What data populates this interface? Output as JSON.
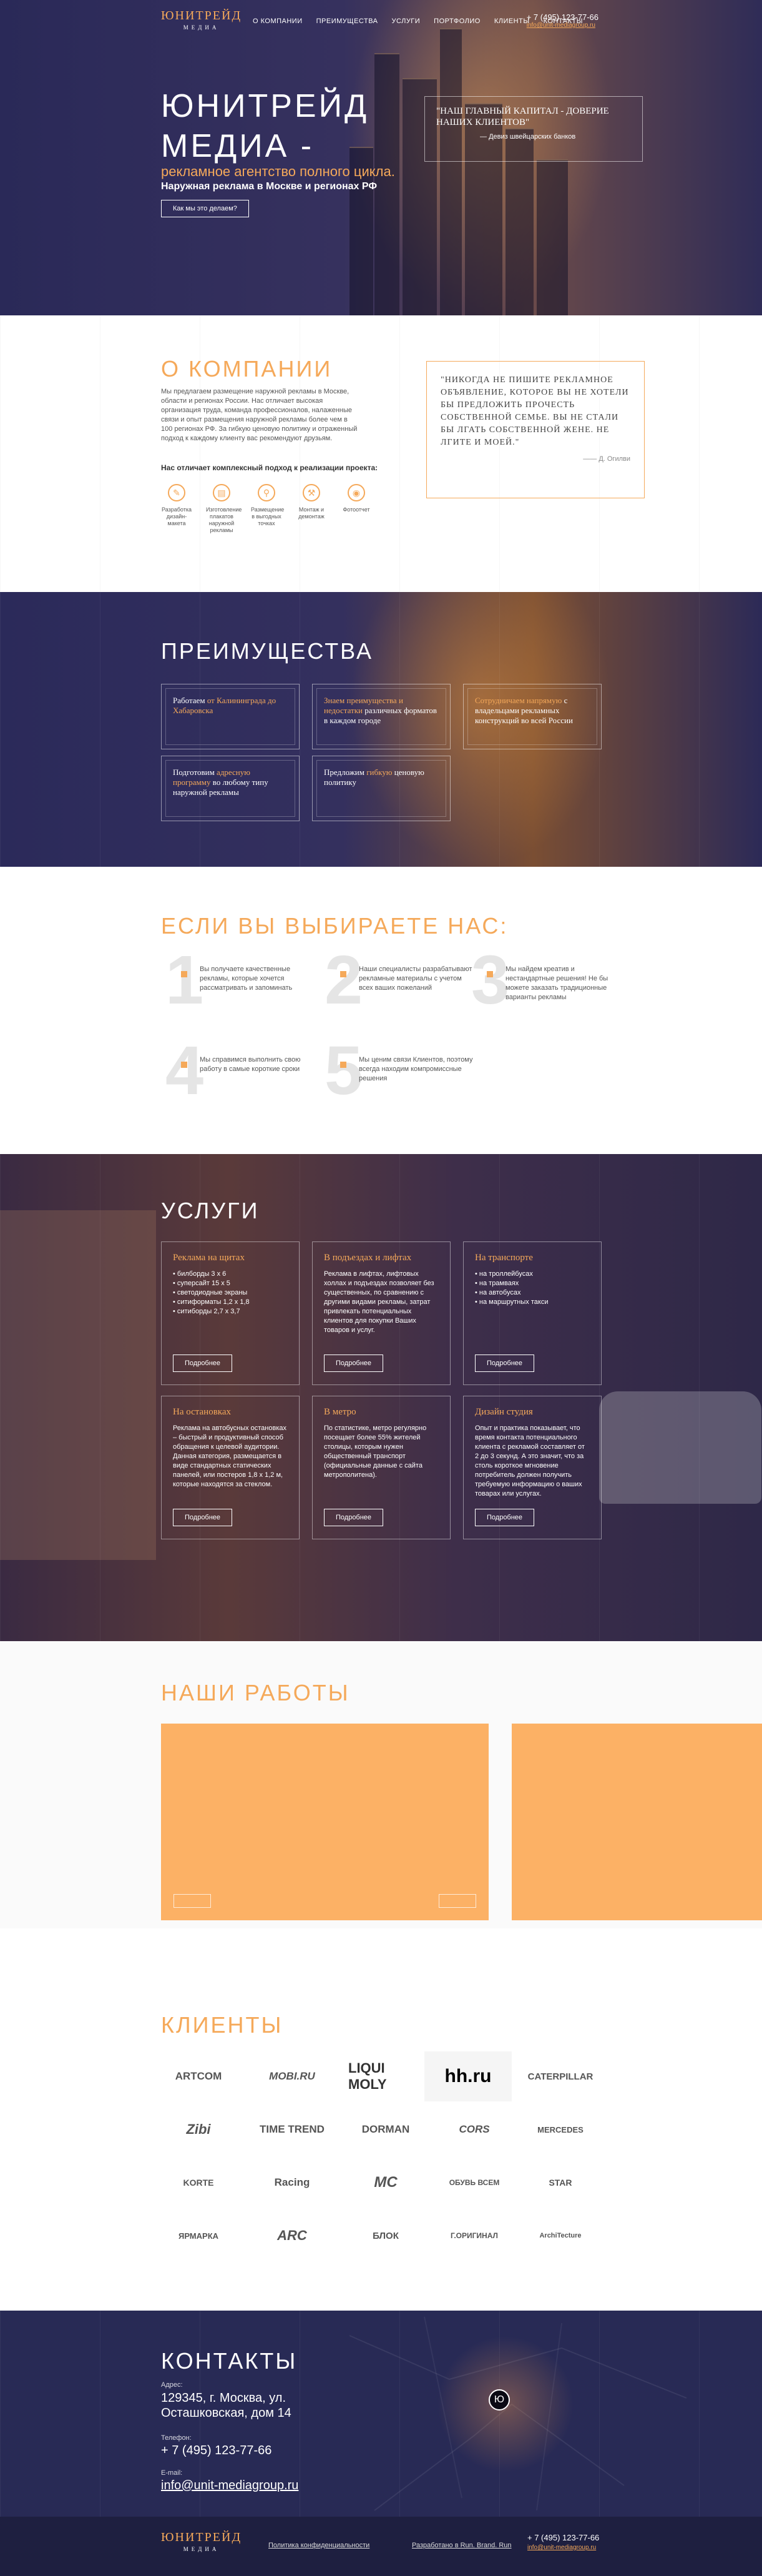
{
  "header": {
    "logo_main": "ЮНИТРЕЙД",
    "logo_sub": "МЕДИА",
    "nav": [
      "О КОМПАНИИ",
      "ПРЕИМУЩЕСТВА",
      "УСЛУГИ",
      "ПОРТФОЛИО",
      "КЛИЕНТЫ",
      "КОНТАКТЫ"
    ],
    "phone": "+ 7 (495) 123-77-66",
    "email": "info@unit-mediagroup.ru"
  },
  "hero": {
    "title_line1": "ЮНИТРЕЙД",
    "title_line2": "МЕДИА -",
    "subtitle": "рекламное агентство полного цикла.",
    "subtitle2": "Наружная реклама в Москве и регионах РФ",
    "button": "Как мы это делаем?",
    "quote": "\"НАШ ГЛАВНЫЙ КАПИТАЛ - ДОВЕРИЕ НАШИХ КЛИЕНТОВ\"",
    "quote_author": "Девиз швейцарских банков"
  },
  "about": {
    "title": "О КОМПАНИИ",
    "text": "Мы предлагаем размещение наружной рекламы в Москве, области и регионах России. Нас отличает высокая организация труда, команда профессионалов, налаженные связи и опыт размещения наружной рекламы более чем в 100 регионах РФ. За гибкую ценовую политику и отраженный подход к каждому клиенту вас рекомендуют друзьям.",
    "lead": "Нас отличает комплексный подход к реализации проекта:",
    "steps": [
      "Разработка дизайн-макета",
      "Изготовление плакатов наружной рекламы",
      "Размещение в выгодных точках",
      "Монтаж и демонтаж",
      "Фотоотчет"
    ],
    "quote": "\"НИКОГДА НЕ ПИШИТЕ РЕКЛАМНОЕ ОБЪЯВЛЕНИЕ, КОТОРОЕ ВЫ НЕ ХОТЕЛИ БЫ ПРЕДЛОЖИТЬ ПРОЧЕСТЬ СОБСТВЕННОЙ СЕМЬЕ. ВЫ НЕ СТАЛИ БЫ ЛГАТЬ СОБСТВЕННОЙ ЖЕНЕ. НЕ ЛГИТЕ И МОЕЙ.\"",
    "quote_author": "Д. Огилви"
  },
  "advantages": {
    "title": "ПРЕИМУЩЕСТВА",
    "cards": [
      {
        "pre": "Работаем ",
        "hi": "от Калининграда до Хабаровска",
        "post": ""
      },
      {
        "pre": "",
        "hi": "Знаем преимущества и недостатки",
        "post": " различных форматов в каждом городе"
      },
      {
        "pre": "",
        "hi": "Сотрудничаем напрямую",
        "post": " с владельцами рекламных конструкций во всей России"
      },
      {
        "pre": "Подготовим ",
        "hi": "адресную программу",
        "post": " во любому типу наружной рекламы"
      },
      {
        "pre": "Предложим ",
        "hi": "гибкую",
        "post": " ценовую политику"
      }
    ]
  },
  "choose": {
    "title": "ЕСЛИ ВЫ ВЫБИРАЕТЕ НАС:",
    "items": [
      {
        "n": "1",
        "t": "Вы получаете качественные рекламы, которые хочется рассматривать и запоминать"
      },
      {
        "n": "2",
        "t": "Наши специалисты разрабатывают рекламные материалы с учетом всех ваших пожеланий"
      },
      {
        "n": "3",
        "t": "Мы найдем креатив и нестандартные решения! Не бы можете заказать традиционные варианты рекламы"
      },
      {
        "n": "4",
        "t": "Мы справимся выполнить свою работу в самые короткие сроки"
      },
      {
        "n": "5",
        "t": "Мы ценим связи Клиентов, поэтому всегда находим компромиссные решения"
      }
    ]
  },
  "services": {
    "title": "УСЛУГИ",
    "more": "Подробнее",
    "cards": [
      {
        "title": "Реклама на щитах",
        "text": "• билборды 3 х 6\n• суперсайт 15 х 5\n• светодиодные экраны\n• ситиформаты 1,2 х 1,8\n• ситиборды 2,7 х 3,7"
      },
      {
        "title": "В подъездах и лифтах",
        "text": "Реклама в лифтах, лифтовых холлах и подъездах позволяет без существенных, по сравнению с другими видами рекламы, затрат привлекать потенциальных клиентов для покупки Ваших товаров и услуг."
      },
      {
        "title": "На транспорте",
        "text": "• на троллейбусах\n• на трамваях\n• на автобусах\n• на маршрутных такси"
      },
      {
        "title": "На остановках",
        "text": "Реклама на автобусных остановках – быстрый и продуктивный способ обращения к целевой аудитории. Данная категория, размещается в виде стандартных статических панелей, или постеров 1,8 х 1,2 м, которые находятся за стеклом."
      },
      {
        "title": "В метро",
        "text": "По статистике, метро регулярно посещает более 55% жителей столицы, которым нужен общественный транспорт (официальные данные с сайта метрополитена)."
      },
      {
        "title": "Дизайн студия",
        "text": "Опыт и практика показывает, что время контакта потенциального клиента с рекламой составляет от 2 до 3 секунд. А это значит, что за столь короткое мгновение потребитель должен получить требуемую информацию о ваших товарах или услугах."
      }
    ]
  },
  "works": {
    "title": "НАШИ РАБОТЫ"
  },
  "clients": {
    "title": "КЛИЕНТЫ",
    "logos": [
      "ARTCOM",
      "MOBI.RU",
      "LIQUI MOLY",
      "hh.ru",
      "CATERPILLAR",
      "Zibi",
      "TIME TREND",
      "DORMAN",
      "CORS",
      "MERCEDES",
      "KORTE",
      "Racing",
      "MC",
      "ОБУВЬ ВСЕМ",
      "STAR",
      "ЯРМАРКА",
      "ARC",
      "БЛОК",
      "Г.ОРИГИНАЛ",
      "ArchiTecture"
    ]
  },
  "contacts": {
    "title": "КОНТАКТЫ",
    "addr_label": "Адрес:",
    "addr": "129345, г. Москва, ул. Осташковская, дом 14",
    "phone_label": "Телефон:",
    "phone": "+ 7 (495) 123-77-66",
    "email_label": "E-mail:",
    "email": "info@unit-mediagroup.ru"
  },
  "footer": {
    "policy": "Политика конфиденциальности",
    "dev": "Разработано в Run. Brand. Run",
    "phone": "+ 7 (495) 123-77-66",
    "email": "info@unit-mediagroup.ru"
  }
}
